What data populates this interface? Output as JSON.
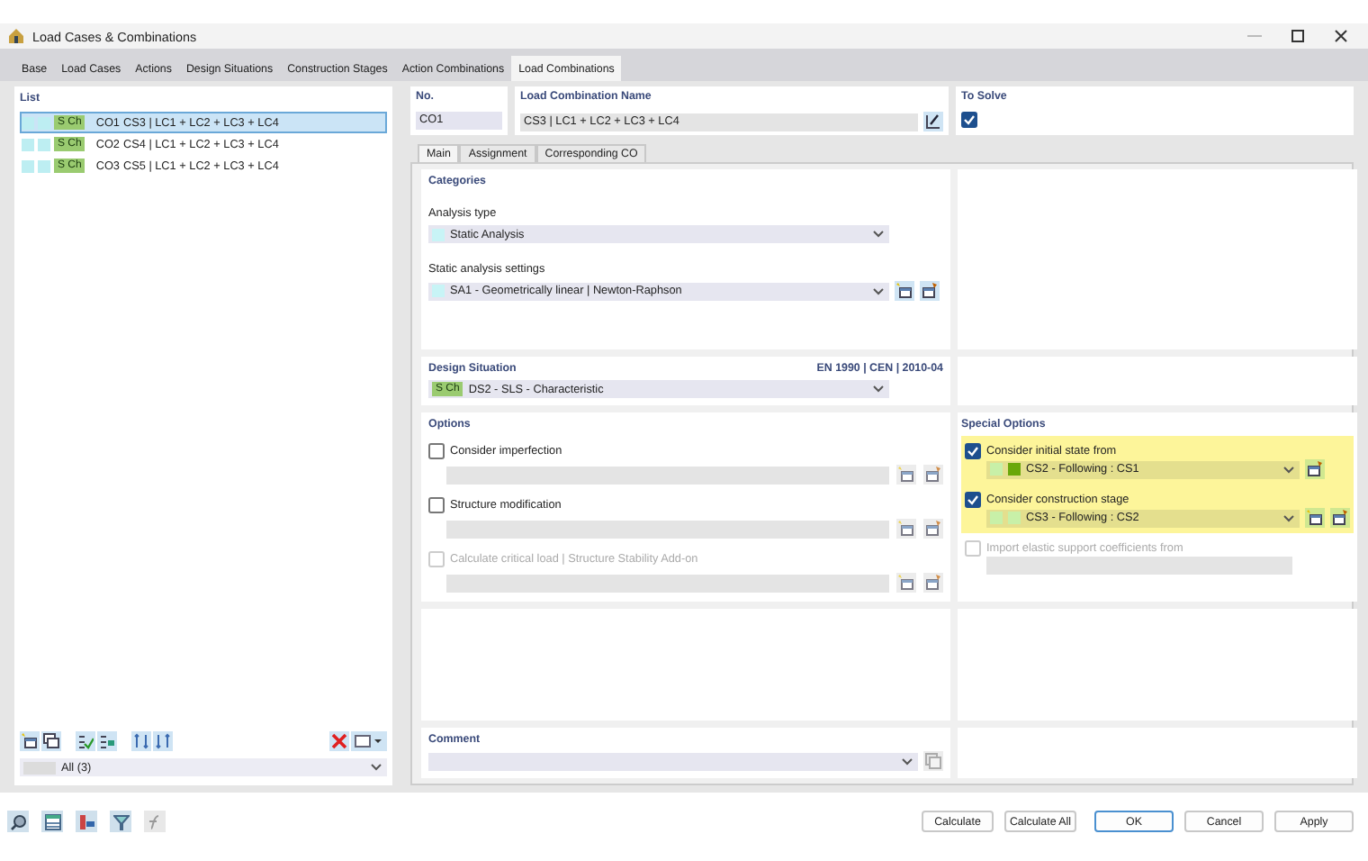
{
  "window": {
    "title": "Load Cases & Combinations"
  },
  "tabs": [
    {
      "label": "Base",
      "selected": false
    },
    {
      "label": "Load Cases",
      "selected": false
    },
    {
      "label": "Actions",
      "selected": false
    },
    {
      "label": "Design Situations",
      "selected": false
    },
    {
      "label": "Construction Stages",
      "selected": false
    },
    {
      "label": "Action Combinations",
      "selected": false
    },
    {
      "label": "Load Combinations",
      "selected": true
    }
  ],
  "list": {
    "title": "List",
    "rows": [
      {
        "tag": "S Ch",
        "no": "CO1",
        "name": "CS3 | LC1 + LC2 + LC3 + LC4",
        "selected": true
      },
      {
        "tag": "S Ch",
        "no": "CO2",
        "name": "CS4 | LC1 + LC2 + LC3 + LC4",
        "selected": false
      },
      {
        "tag": "S Ch",
        "no": "CO3",
        "name": "CS5 | LC1 + LC2 + LC3 + LC4",
        "selected": false
      }
    ],
    "filter": "All (3)"
  },
  "header": {
    "number_label": "No.",
    "number": "CO1",
    "name_label": "Load Combination Name",
    "name": "CS3 | LC1 + LC2 + LC3 + LC4",
    "to_solve_label": "To Solve",
    "to_solve": true
  },
  "subtabs": [
    {
      "label": "Main",
      "selected": true
    },
    {
      "label": "Assignment",
      "selected": false
    },
    {
      "label": "Corresponding CO",
      "selected": false
    }
  ],
  "categories": {
    "title": "Categories",
    "analysis_type_label": "Analysis type",
    "analysis_type": "Static Analysis",
    "settings_label": "Static analysis settings",
    "settings": "SA1 - Geometrically linear | Newton-Raphson"
  },
  "design_situation": {
    "title": "Design Situation",
    "standard": "EN 1990 | CEN | 2010-04",
    "tag": "S Ch",
    "value": "DS2 - SLS - Characteristic"
  },
  "options": {
    "title": "Options",
    "items": [
      {
        "label": "Consider imperfection",
        "checked": false,
        "disabled": false
      },
      {
        "label": "Structure modification",
        "checked": false,
        "disabled": false
      },
      {
        "label": "Calculate critical load | Structure Stability Add-on",
        "checked": false,
        "disabled": true
      }
    ]
  },
  "special_options": {
    "title": "Special Options",
    "items": [
      {
        "label": "Consider initial state from",
        "checked": true,
        "disabled": false,
        "new_button": false,
        "value": "CS2 - Following : CS1",
        "swatches": [
          {
            "color": "#c8f0a8"
          },
          {
            "color": "#6aa80a"
          }
        ]
      },
      {
        "label": "Consider construction stage",
        "checked": true,
        "disabled": false,
        "new_button": true,
        "value": "CS3 - Following : CS2",
        "swatches": [
          {
            "color": "#c8f0a8"
          },
          {
            "color": "#c8f0a8"
          }
        ]
      },
      {
        "label": "Import elastic support coefficients from",
        "checked": false,
        "disabled": true
      }
    ]
  },
  "comment": {
    "title": "Comment"
  },
  "buttons": [
    {
      "label": "Calculate",
      "default": false
    },
    {
      "label": "Calculate All",
      "default": false
    },
    {
      "label": "OK",
      "default": true
    },
    {
      "label": "Cancel",
      "default": false
    },
    {
      "label": "Apply",
      "default": false
    }
  ]
}
